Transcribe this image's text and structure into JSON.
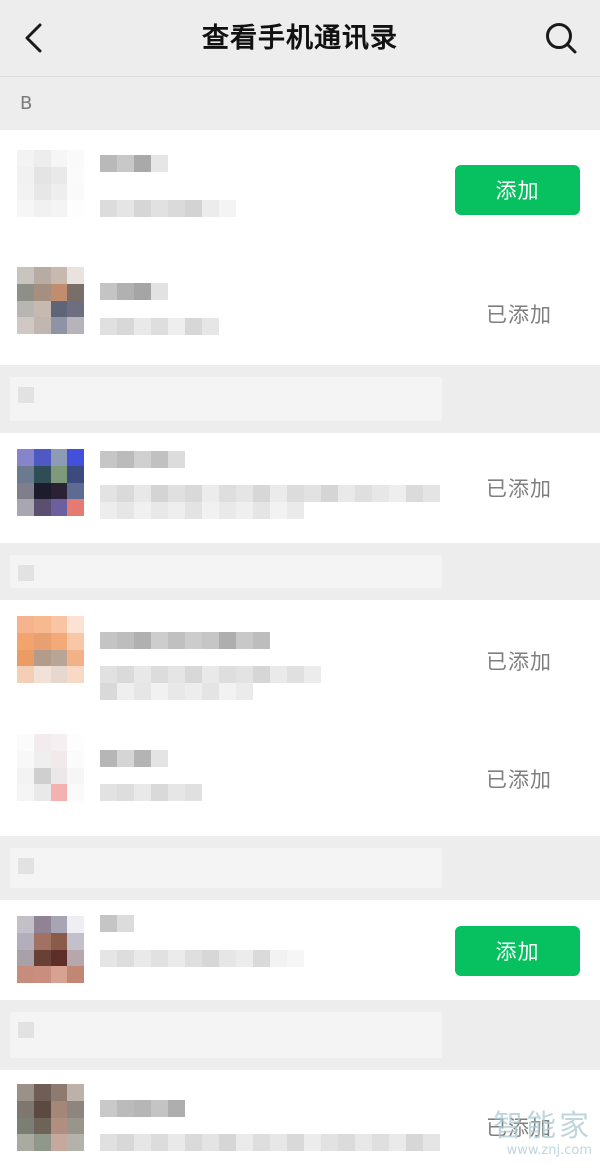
{
  "header": {
    "title": "查看手机通讯录"
  },
  "section": {
    "letter": "B"
  },
  "contacts": [
    {
      "status": "add",
      "label": "添加"
    },
    {
      "status": "added",
      "label": "已添加"
    },
    {
      "status": "added",
      "label": "已添加"
    },
    {
      "status": "added",
      "label": "已添加"
    },
    {
      "status": "added",
      "label": "已添加"
    },
    {
      "status": "add",
      "label": "添加"
    },
    {
      "status": "added",
      "label": "已添加"
    }
  ],
  "colors": {
    "accent_green": "#07c160",
    "background": "#ededed",
    "added_text": "#7f7f7f"
  },
  "icons": {
    "back": "chevron-left-icon",
    "search": "search-icon"
  },
  "watermark": {
    "main": "智能家",
    "url": "www.znj.com"
  }
}
